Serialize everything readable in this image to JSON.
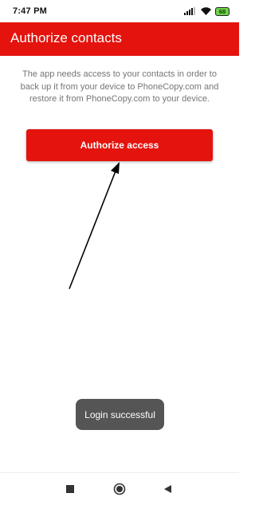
{
  "status_bar": {
    "time": "7:47 PM",
    "battery_level": "68",
    "icons": [
      "signal-icon",
      "wifi-icon",
      "battery-icon"
    ]
  },
  "app_bar": {
    "title": "Authorize contacts",
    "color": "#e4130d"
  },
  "main": {
    "description": "The app needs access to your contacts in order to back up it from your device to PhoneCopy.com and restore it from PhoneCopy.com to your device.",
    "authorize_label": "Authorize access",
    "accent_color": "#e4130d"
  },
  "toast": {
    "message": "Login successful"
  },
  "nav_bar": {
    "icons": [
      "recents-square-icon",
      "home-circle-icon",
      "back-triangle-icon"
    ]
  }
}
